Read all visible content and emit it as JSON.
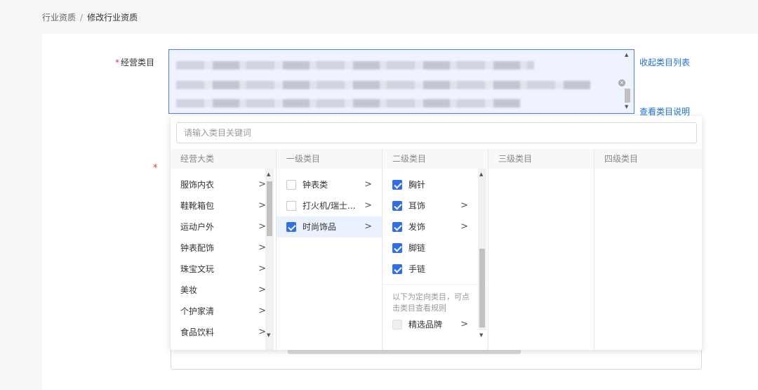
{
  "breadcrumb": {
    "parent": "行业资质",
    "separator": "/",
    "current": "修改行业资质"
  },
  "form": {
    "required_mark": "*",
    "field_label": "经营类目",
    "second_required_mark": "*"
  },
  "links": {
    "collapse_list": "收起类目列表",
    "view_explanation": "查看类目说明"
  },
  "search": {
    "placeholder": "请输入类目关键词",
    "value": ""
  },
  "columns": {
    "c0": "经营大类",
    "c1": "一级类目",
    "c2": "二级类目",
    "c3": "三级类目",
    "c4": "四级类目"
  },
  "col0_items": [
    {
      "label": "服饰内衣",
      "arrow": ">"
    },
    {
      "label": "鞋靴箱包",
      "arrow": ">"
    },
    {
      "label": "运动户外",
      "arrow": ">"
    },
    {
      "label": "钟表配饰",
      "arrow": ">"
    },
    {
      "label": "珠宝文玩",
      "arrow": ">"
    },
    {
      "label": "美妆",
      "arrow": ">"
    },
    {
      "label": "个护家清",
      "arrow": ">"
    },
    {
      "label": "食品饮料",
      "arrow": ">"
    }
  ],
  "col1_items": [
    {
      "label": "钟表类",
      "arrow": ">",
      "checked": false
    },
    {
      "label": "打火机/瑞士...",
      "arrow": ">",
      "checked": false
    },
    {
      "label": "时尚饰品",
      "arrow": ">",
      "checked": true
    }
  ],
  "col2_items": [
    {
      "label": "胸针",
      "arrow": "",
      "checked": true
    },
    {
      "label": "耳饰",
      "arrow": ">",
      "checked": true
    },
    {
      "label": "发饰",
      "arrow": ">",
      "checked": true
    },
    {
      "label": "脚链",
      "arrow": "",
      "checked": true
    },
    {
      "label": "手链",
      "arrow": "",
      "checked": true
    }
  ],
  "col2_note": "以下为定向类目，可点击类目查看规则",
  "col2_directed_item": {
    "label": "精选品牌",
    "arrow": ">",
    "checked": false
  },
  "colors": {
    "accent": "#2f6fed",
    "link": "#1f6fe5",
    "required": "#e4393c",
    "active_row": "#eaf1ff"
  }
}
